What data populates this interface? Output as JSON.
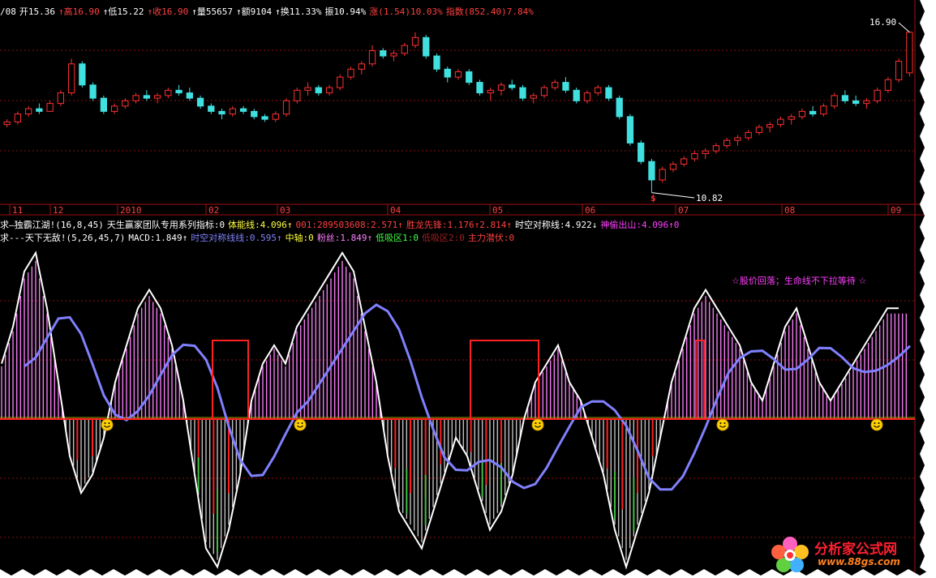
{
  "header": {
    "fields": [
      {
        "text": "/08",
        "color": "#ffffff"
      },
      {
        "text": "开15.36",
        "color": "#ffffff"
      },
      {
        "text": "↑高16.90",
        "color": "#ff4040"
      },
      {
        "text": "↑低15.22",
        "color": "#ffffff"
      },
      {
        "text": "↑收16.90",
        "color": "#ff4040"
      },
      {
        "text": "↑量55657",
        "color": "#ffffff"
      },
      {
        "text": "↑额9104",
        "color": "#ffffff"
      },
      {
        "text": "↑换11.33%",
        "color": "#ffffff"
      },
      {
        "text": "振10.94%",
        "color": "#ffffff"
      },
      {
        "text": "涨(1.54)10.03%",
        "color": "#ff4040"
      },
      {
        "text": "指数(852.40)7.84%",
        "color": "#ff4040"
      }
    ]
  },
  "indicator1": {
    "fields": [
      {
        "text": "求—独霸江湖!(16,8,45)",
        "color": "#ffffff"
      },
      {
        "text": "天生赢家团队专用系列指标:0",
        "color": "#ffffff"
      },
      {
        "text": "体能线:4.096↑",
        "color": "#ffff40"
      },
      {
        "text": "001:289503608:2.571↑",
        "color": "#ff4040"
      },
      {
        "text": "胜龙先锋:1.176↑2.814↑",
        "color": "#ff4040"
      },
      {
        "text": "时空对称线:4.922↓",
        "color": "#ffffff"
      },
      {
        "text": "神偷出山:4.096↑0",
        "color": "#ff40ff"
      }
    ]
  },
  "indicator2": {
    "fields": [
      {
        "text": "求---天下无敌!(5,26,45,7)",
        "color": "#ffffff"
      },
      {
        "text": "MACD:1.849↑",
        "color": "#ffffff"
      },
      {
        "text": "时空对称线线:0.595↑",
        "color": "#8080ff"
      },
      {
        "text": "中轴:0",
        "color": "#ffff40"
      },
      {
        "text": "粉丝:1.849↑",
        "color": "#ff80ff"
      },
      {
        "text": "低吸区1:0",
        "color": "#40ff40"
      },
      {
        "text": "低吸区2:0",
        "color": "#a02020"
      },
      {
        "text": "主力潜伏:0",
        "color": "#ff4040"
      }
    ]
  },
  "annotations": {
    "price_high": "16.90",
    "price_low": "10.82",
    "low_marker": "$",
    "note": "☆股价回落；生命线不下拉等待 ☆"
  },
  "logo": {
    "title": "分析家公式网",
    "url": "www.88gs.com"
  },
  "chart_data": [
    {
      "type": "candlestick",
      "x_ticks": [
        "11",
        "12",
        "2010",
        "02",
        "03",
        "04",
        "05",
        "06",
        "07",
        "08",
        "09"
      ],
      "ylim": [
        10.5,
        17.2
      ],
      "series": [
        {
          "values": [
            [
              13.4,
              13.6,
              13.3,
              13.5
            ],
            [
              13.5,
              13.9,
              13.4,
              13.8
            ],
            [
              13.8,
              14.1,
              13.7,
              14.0
            ],
            [
              14.0,
              14.2,
              13.8,
              13.9
            ],
            [
              13.9,
              14.3,
              13.9,
              14.2
            ],
            [
              14.2,
              14.7,
              14.1,
              14.6
            ],
            [
              14.6,
              15.9,
              14.5,
              15.7
            ],
            [
              15.7,
              15.8,
              14.8,
              14.9
            ],
            [
              14.9,
              15.0,
              14.3,
              14.4
            ],
            [
              14.4,
              14.5,
              13.8,
              13.9
            ],
            [
              13.9,
              14.2,
              13.8,
              14.1
            ],
            [
              14.1,
              14.4,
              14.0,
              14.3
            ],
            [
              14.3,
              14.6,
              14.2,
              14.5
            ],
            [
              14.5,
              14.7,
              14.3,
              14.4
            ],
            [
              14.4,
              14.6,
              14.2,
              14.5
            ],
            [
              14.5,
              14.8,
              14.4,
              14.7
            ],
            [
              14.7,
              14.9,
              14.5,
              14.6
            ],
            [
              14.6,
              14.8,
              14.3,
              14.4
            ],
            [
              14.4,
              14.5,
              14.0,
              14.1
            ],
            [
              14.1,
              14.2,
              13.8,
              13.9
            ],
            [
              13.9,
              14.0,
              13.6,
              13.8
            ],
            [
              13.8,
              14.1,
              13.7,
              14.0
            ],
            [
              14.0,
              14.1,
              13.8,
              13.9
            ],
            [
              13.9,
              14.0,
              13.6,
              13.7
            ],
            [
              13.7,
              13.8,
              13.5,
              13.6
            ],
            [
              13.6,
              13.9,
              13.5,
              13.8
            ],
            [
              13.8,
              14.4,
              13.7,
              14.3
            ],
            [
              14.3,
              14.8,
              14.2,
              14.7
            ],
            [
              14.7,
              15.0,
              14.5,
              14.8
            ],
            [
              14.8,
              14.9,
              14.5,
              14.6
            ],
            [
              14.6,
              14.9,
              14.5,
              14.8
            ],
            [
              14.8,
              15.3,
              14.7,
              15.2
            ],
            [
              15.2,
              15.6,
              15.1,
              15.5
            ],
            [
              15.5,
              15.8,
              15.3,
              15.7
            ],
            [
              15.7,
              16.4,
              15.6,
              16.2
            ],
            [
              16.2,
              16.3,
              15.9,
              16.0
            ],
            [
              16.0,
              16.2,
              15.8,
              16.1
            ],
            [
              16.1,
              16.5,
              16.0,
              16.4
            ],
            [
              16.4,
              16.9,
              16.3,
              16.7
            ],
            [
              16.7,
              16.8,
              15.9,
              16.0
            ],
            [
              16.0,
              16.1,
              15.4,
              15.5
            ],
            [
              15.5,
              15.6,
              15.0,
              15.2
            ],
            [
              15.2,
              15.5,
              15.1,
              15.4
            ],
            [
              15.4,
              15.5,
              14.9,
              15.0
            ],
            [
              15.0,
              15.1,
              14.5,
              14.6
            ],
            [
              14.6,
              14.8,
              14.3,
              14.7
            ],
            [
              14.7,
              15.0,
              14.5,
              14.9
            ],
            [
              14.9,
              15.1,
              14.7,
              14.8
            ],
            [
              14.8,
              14.9,
              14.3,
              14.4
            ],
            [
              14.4,
              14.6,
              14.2,
              14.5
            ],
            [
              14.5,
              14.9,
              14.4,
              14.8
            ],
            [
              14.8,
              15.1,
              14.7,
              15.0
            ],
            [
              15.0,
              15.2,
              14.6,
              14.7
            ],
            [
              14.7,
              14.8,
              14.2,
              14.3
            ],
            [
              14.3,
              14.7,
              14.2,
              14.6
            ],
            [
              14.6,
              14.9,
              14.5,
              14.8
            ],
            [
              14.8,
              14.9,
              14.3,
              14.4
            ],
            [
              14.4,
              14.5,
              13.6,
              13.7
            ],
            [
              13.7,
              13.8,
              12.6,
              12.7
            ],
            [
              12.7,
              12.8,
              11.9,
              12.0
            ],
            [
              12.0,
              12.1,
              10.82,
              11.3
            ],
            [
              11.3,
              11.8,
              11.2,
              11.7
            ],
            [
              11.7,
              12.0,
              11.6,
              11.9
            ],
            [
              11.9,
              12.2,
              11.8,
              12.1
            ],
            [
              12.1,
              12.4,
              12.0,
              12.3
            ],
            [
              12.3,
              12.5,
              12.1,
              12.4
            ],
            [
              12.4,
              12.7,
              12.3,
              12.6
            ],
            [
              12.6,
              12.9,
              12.5,
              12.8
            ],
            [
              12.8,
              13.0,
              12.6,
              12.9
            ],
            [
              12.9,
              13.2,
              12.8,
              13.1
            ],
            [
              13.1,
              13.4,
              13.0,
              13.3
            ],
            [
              13.3,
              13.5,
              13.1,
              13.4
            ],
            [
              13.4,
              13.7,
              13.3,
              13.6
            ],
            [
              13.6,
              13.8,
              13.4,
              13.7
            ],
            [
              13.7,
              14.0,
              13.6,
              13.9
            ],
            [
              13.9,
              14.1,
              13.7,
              13.8
            ],
            [
              13.8,
              14.2,
              13.7,
              14.1
            ],
            [
              14.1,
              14.6,
              14.0,
              14.5
            ],
            [
              14.5,
              14.7,
              14.2,
              14.3
            ],
            [
              14.3,
              14.5,
              14.1,
              14.2
            ],
            [
              14.2,
              14.4,
              14.0,
              14.3
            ],
            [
              14.3,
              14.8,
              14.2,
              14.7
            ],
            [
              14.7,
              15.2,
              14.6,
              15.1
            ],
            [
              15.1,
              15.9,
              15.0,
              15.8
            ],
            [
              15.36,
              16.9,
              15.22,
              16.9
            ]
          ]
        }
      ]
    },
    {
      "type": "bar",
      "ylim": [
        -10,
        10
      ],
      "series": [
        {
          "name": "MACD",
          "values": [
            3.0,
            5.0,
            8.0,
            9.0,
            6.0,
            2.0,
            -2.0,
            -4.0,
            -3.0,
            -1.0,
            2.0,
            4.0,
            6.0,
            7.0,
            6.0,
            4.0,
            1.0,
            -3.0,
            -7.0,
            -8.0,
            -6.0,
            -3.0,
            1.0,
            3.0,
            4.0,
            3.0,
            5.0,
            6.0,
            7.0,
            8.0,
            9.0,
            8.0,
            5.0,
            2.0,
            -2.0,
            -5.0,
            -6.0,
            -7.0,
            -5.0,
            -3.0,
            -1.0,
            -2.0,
            -4.0,
            -6.0,
            -5.0,
            -3.0,
            0.0,
            2.0,
            3.0,
            4.0,
            2.0,
            1.0,
            -1.0,
            -3.0,
            -6.0,
            -8.0,
            -6.0,
            -4.0,
            -1.0,
            2.0,
            4.0,
            6.0,
            7.0,
            6.0,
            5.0,
            4.0,
            2.0,
            1.0,
            3.0,
            5.0,
            6.0,
            4.0,
            2.0,
            1.0,
            2.0,
            3.0,
            4.0,
            5.0,
            6.0,
            6.0
          ]
        }
      ]
    }
  ]
}
